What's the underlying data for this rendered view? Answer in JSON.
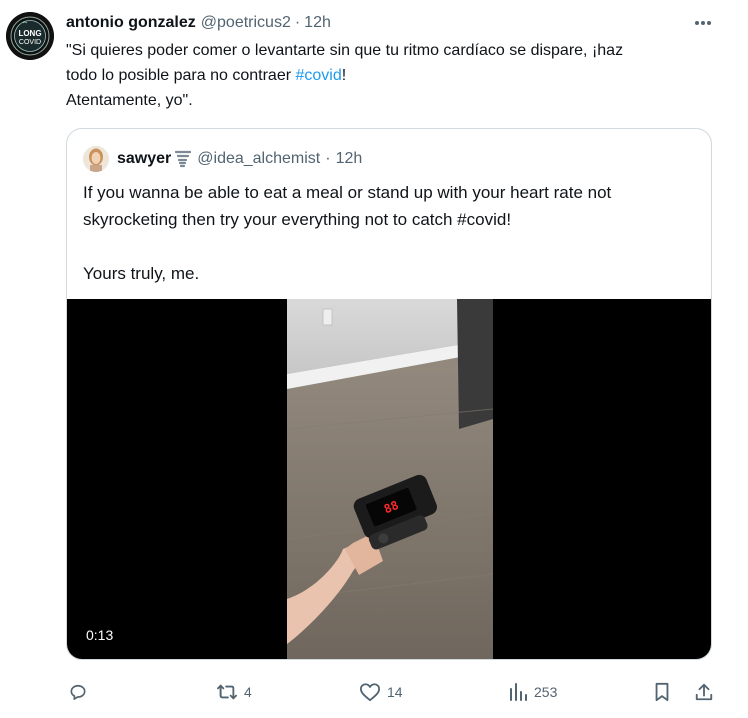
{
  "tweet": {
    "author": {
      "name": "antonio gonzalez",
      "handle": "@poetricus2",
      "time": "12h",
      "separator": "·",
      "avatar_text_top": "LONG",
      "avatar_text_bottom": "COVID"
    },
    "text": {
      "line1": "\"Si quieres poder comer o levantarte sin que tu ritmo cardíaco se dispare, ¡haz",
      "line2_pre": "todo lo posible para no contraer ",
      "hashtag": "#covid",
      "line2_post": "!",
      "line3": "Atentamente, yo\"."
    },
    "more_icon": "more-horizontal-icon"
  },
  "quote": {
    "author": {
      "name": "sawyer",
      "emoji_icon": "tornado-icon",
      "handle": "@idea_alchemist",
      "separator": "·",
      "time": "12h"
    },
    "text": {
      "line1": "If you wanna be able to eat a meal or stand up with your heart rate not",
      "line2": "skyrocketing then try your everything not to catch #covid!",
      "line3": "Yours truly, me."
    },
    "video": {
      "duration": "0:13"
    }
  },
  "actions": {
    "reply": {
      "icon": "reply-icon",
      "count": ""
    },
    "retweet": {
      "icon": "retweet-icon",
      "count": "4"
    },
    "like": {
      "icon": "heart-icon",
      "count": "14"
    },
    "views": {
      "icon": "views-icon",
      "count": "253"
    },
    "bookmark": {
      "icon": "bookmark-icon"
    },
    "share": {
      "icon": "share-icon"
    }
  },
  "colors": {
    "link": "#1d9bf0",
    "secondary_text": "#536471",
    "border": "#cfd9de"
  }
}
